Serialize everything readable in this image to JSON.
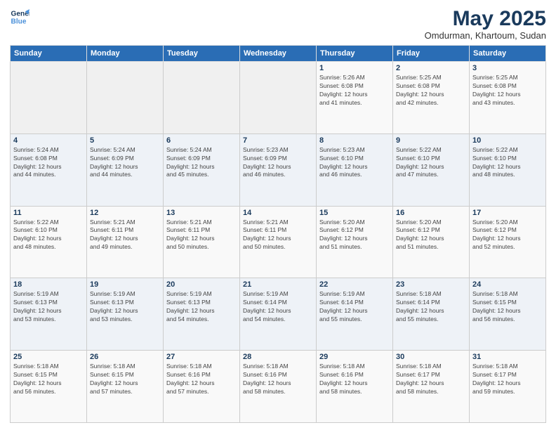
{
  "logo": {
    "line1": "General",
    "line2": "Blue"
  },
  "title": "May 2025",
  "subtitle": "Omdurman, Khartoum, Sudan",
  "headers": [
    "Sunday",
    "Monday",
    "Tuesday",
    "Wednesday",
    "Thursday",
    "Friday",
    "Saturday"
  ],
  "weeks": [
    [
      {
        "day": "",
        "info": ""
      },
      {
        "day": "",
        "info": ""
      },
      {
        "day": "",
        "info": ""
      },
      {
        "day": "",
        "info": ""
      },
      {
        "day": "1",
        "info": "Sunrise: 5:26 AM\nSunset: 6:08 PM\nDaylight: 12 hours\nand 41 minutes."
      },
      {
        "day": "2",
        "info": "Sunrise: 5:25 AM\nSunset: 6:08 PM\nDaylight: 12 hours\nand 42 minutes."
      },
      {
        "day": "3",
        "info": "Sunrise: 5:25 AM\nSunset: 6:08 PM\nDaylight: 12 hours\nand 43 minutes."
      }
    ],
    [
      {
        "day": "4",
        "info": "Sunrise: 5:24 AM\nSunset: 6:08 PM\nDaylight: 12 hours\nand 44 minutes."
      },
      {
        "day": "5",
        "info": "Sunrise: 5:24 AM\nSunset: 6:09 PM\nDaylight: 12 hours\nand 44 minutes."
      },
      {
        "day": "6",
        "info": "Sunrise: 5:24 AM\nSunset: 6:09 PM\nDaylight: 12 hours\nand 45 minutes."
      },
      {
        "day": "7",
        "info": "Sunrise: 5:23 AM\nSunset: 6:09 PM\nDaylight: 12 hours\nand 46 minutes."
      },
      {
        "day": "8",
        "info": "Sunrise: 5:23 AM\nSunset: 6:10 PM\nDaylight: 12 hours\nand 46 minutes."
      },
      {
        "day": "9",
        "info": "Sunrise: 5:22 AM\nSunset: 6:10 PM\nDaylight: 12 hours\nand 47 minutes."
      },
      {
        "day": "10",
        "info": "Sunrise: 5:22 AM\nSunset: 6:10 PM\nDaylight: 12 hours\nand 48 minutes."
      }
    ],
    [
      {
        "day": "11",
        "info": "Sunrise: 5:22 AM\nSunset: 6:10 PM\nDaylight: 12 hours\nand 48 minutes."
      },
      {
        "day": "12",
        "info": "Sunrise: 5:21 AM\nSunset: 6:11 PM\nDaylight: 12 hours\nand 49 minutes."
      },
      {
        "day": "13",
        "info": "Sunrise: 5:21 AM\nSunset: 6:11 PM\nDaylight: 12 hours\nand 50 minutes."
      },
      {
        "day": "14",
        "info": "Sunrise: 5:21 AM\nSunset: 6:11 PM\nDaylight: 12 hours\nand 50 minutes."
      },
      {
        "day": "15",
        "info": "Sunrise: 5:20 AM\nSunset: 6:12 PM\nDaylight: 12 hours\nand 51 minutes."
      },
      {
        "day": "16",
        "info": "Sunrise: 5:20 AM\nSunset: 6:12 PM\nDaylight: 12 hours\nand 51 minutes."
      },
      {
        "day": "17",
        "info": "Sunrise: 5:20 AM\nSunset: 6:12 PM\nDaylight: 12 hours\nand 52 minutes."
      }
    ],
    [
      {
        "day": "18",
        "info": "Sunrise: 5:19 AM\nSunset: 6:13 PM\nDaylight: 12 hours\nand 53 minutes."
      },
      {
        "day": "19",
        "info": "Sunrise: 5:19 AM\nSunset: 6:13 PM\nDaylight: 12 hours\nand 53 minutes."
      },
      {
        "day": "20",
        "info": "Sunrise: 5:19 AM\nSunset: 6:13 PM\nDaylight: 12 hours\nand 54 minutes."
      },
      {
        "day": "21",
        "info": "Sunrise: 5:19 AM\nSunset: 6:14 PM\nDaylight: 12 hours\nand 54 minutes."
      },
      {
        "day": "22",
        "info": "Sunrise: 5:19 AM\nSunset: 6:14 PM\nDaylight: 12 hours\nand 55 minutes."
      },
      {
        "day": "23",
        "info": "Sunrise: 5:18 AM\nSunset: 6:14 PM\nDaylight: 12 hours\nand 55 minutes."
      },
      {
        "day": "24",
        "info": "Sunrise: 5:18 AM\nSunset: 6:15 PM\nDaylight: 12 hours\nand 56 minutes."
      }
    ],
    [
      {
        "day": "25",
        "info": "Sunrise: 5:18 AM\nSunset: 6:15 PM\nDaylight: 12 hours\nand 56 minutes."
      },
      {
        "day": "26",
        "info": "Sunrise: 5:18 AM\nSunset: 6:15 PM\nDaylight: 12 hours\nand 57 minutes."
      },
      {
        "day": "27",
        "info": "Sunrise: 5:18 AM\nSunset: 6:16 PM\nDaylight: 12 hours\nand 57 minutes."
      },
      {
        "day": "28",
        "info": "Sunrise: 5:18 AM\nSunset: 6:16 PM\nDaylight: 12 hours\nand 58 minutes."
      },
      {
        "day": "29",
        "info": "Sunrise: 5:18 AM\nSunset: 6:16 PM\nDaylight: 12 hours\nand 58 minutes."
      },
      {
        "day": "30",
        "info": "Sunrise: 5:18 AM\nSunset: 6:17 PM\nDaylight: 12 hours\nand 58 minutes."
      },
      {
        "day": "31",
        "info": "Sunrise: 5:18 AM\nSunset: 6:17 PM\nDaylight: 12 hours\nand 59 minutes."
      }
    ]
  ]
}
